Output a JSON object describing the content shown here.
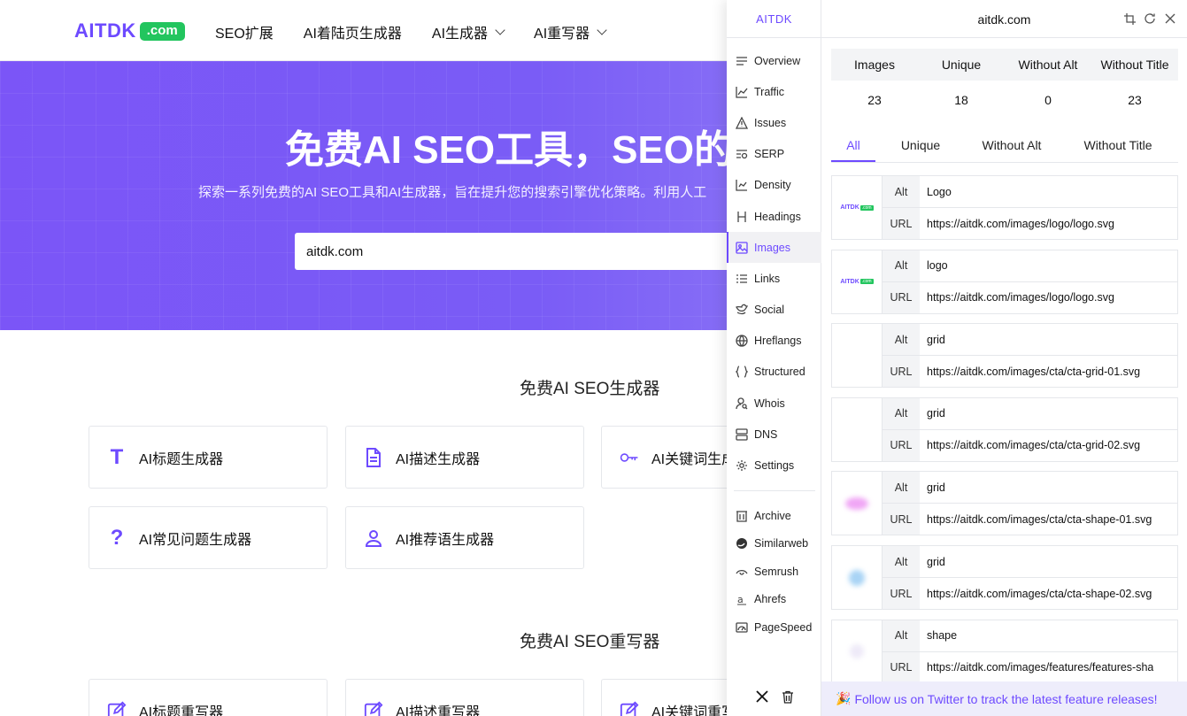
{
  "site": {
    "logo_text": "AITDK",
    "logo_badge": ".com",
    "nav": [
      {
        "label": "SEO扩展",
        "has_menu": false
      },
      {
        "label": "AI着陆页生成器",
        "has_menu": false
      },
      {
        "label": "AI生成器",
        "has_menu": true
      },
      {
        "label": "AI重写器",
        "has_menu": true
      }
    ],
    "hero_title": "免费AI SEO工具，SEO的",
    "hero_subtitle": "探索一系列免费的AI SEO工具和AI生成器，旨在提升您的搜索引擎优化策略。利用人工",
    "search_value": "aitdk.com",
    "section1_title": "免费AI SEO生成器",
    "section1_cards": [
      "AI标题生成器",
      "AI描述生成器",
      "AI关键词生成",
      "AI常见问题生成器",
      "AI推荐语生成器"
    ],
    "section2_title": "免费AI SEO重写器",
    "section2_cards": [
      "AI标题重写器",
      "AI描述重写器",
      "AI关键词重写"
    ]
  },
  "ext": {
    "brand": "AITDK",
    "domain": "aitdk.com",
    "sidebar": [
      {
        "label": "Overview",
        "icon": "list-icon"
      },
      {
        "label": "Traffic",
        "icon": "chart-icon"
      },
      {
        "label": "Issues",
        "icon": "warning-icon"
      },
      {
        "label": "SERP",
        "icon": "serp-icon"
      },
      {
        "label": "Density",
        "icon": "density-icon"
      },
      {
        "label": "Headings",
        "icon": "heading-icon"
      },
      {
        "label": "Images",
        "icon": "image-icon",
        "active": true
      },
      {
        "label": "Links",
        "icon": "links-icon"
      },
      {
        "label": "Social",
        "icon": "bird-icon"
      },
      {
        "label": "Hreflangs",
        "icon": "globe-icon"
      },
      {
        "label": "Structured",
        "icon": "braces-icon"
      },
      {
        "label": "Whois",
        "icon": "user-search-icon"
      },
      {
        "label": "DNS",
        "icon": "server-icon"
      },
      {
        "label": "Settings",
        "icon": "gear-icon"
      }
    ],
    "sidebar_external": [
      {
        "label": "Archive",
        "icon": "archive-icon"
      },
      {
        "label": "Similarweb",
        "icon": "similarweb-icon"
      },
      {
        "label": "Semrush",
        "icon": "semrush-icon"
      },
      {
        "label": "Ahrefs",
        "icon": "ahrefs-icon"
      },
      {
        "label": "PageSpeed",
        "icon": "pagespeed-icon"
      }
    ],
    "stats": {
      "headers": [
        "Images",
        "Unique",
        "Without Alt",
        "Without Title"
      ],
      "values": [
        "23",
        "18",
        "0",
        "23"
      ]
    },
    "tabs": [
      "All",
      "Unique",
      "Without Alt",
      "Without Title"
    ],
    "alt_label": "Alt",
    "url_label": "URL",
    "images": [
      {
        "alt": "Logo",
        "url": "https://aitdk.com/images/logo/logo.svg",
        "thumb": "logo"
      },
      {
        "alt": "logo",
        "url": "https://aitdk.com/images/logo/logo.svg",
        "thumb": "logo"
      },
      {
        "alt": "grid",
        "url": "https://aitdk.com/images/cta/cta-grid-01.svg",
        "thumb": "blank"
      },
      {
        "alt": "grid",
        "url": "https://aitdk.com/images/cta/cta-grid-02.svg",
        "thumb": "blank"
      },
      {
        "alt": "grid",
        "url": "https://aitdk.com/images/cta/cta-shape-01.svg",
        "thumb": "pink"
      },
      {
        "alt": "grid",
        "url": "https://aitdk.com/images/cta/cta-shape-02.svg",
        "thumb": "blue"
      },
      {
        "alt": "shape",
        "url": "https://aitdk.com/images/features/features-sha",
        "thumb": "faint"
      }
    ],
    "footer_text": "Follow us on Twitter to track the latest feature releases!",
    "footer_emoji": "🎉",
    "accent": "#6d4aff"
  }
}
